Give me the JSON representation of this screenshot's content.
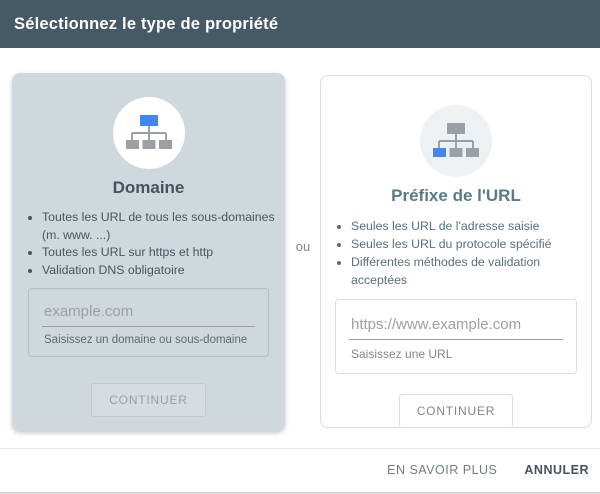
{
  "dialog": {
    "title": "Sélectionnez le type de propriété"
  },
  "divider_label": "ou",
  "cards": {
    "domain": {
      "title": "Domaine",
      "icon": "sitemap-tree-icon-blue-root",
      "bullets": [
        "Toutes les URL de tous les sous-domaines (m. www. ...)",
        "Toutes les URL sur https et http",
        "Validation DNS obligatoire"
      ],
      "input": {
        "value": "",
        "placeholder": "example.com",
        "helper": "Saisissez un domaine ou sous-domaine"
      },
      "button": "CONTINUER"
    },
    "url_prefix": {
      "title": "Préfixe de l'URL",
      "icon": "sitemap-tree-icon-blue-leaf",
      "bullets": [
        "Seules les URL de l'adresse saisie",
        "Seules les URL du protocole spécifié",
        "Différentes méthodes de validation acceptées"
      ],
      "input": {
        "value": "",
        "placeholder": "https://www.example.com",
        "helper": "Saisissez une URL"
      },
      "button": "CONTINUER"
    }
  },
  "footer": {
    "learn_more": "EN SAVOIR PLUS",
    "cancel": "ANNULER"
  },
  "colors": {
    "header_bg": "#455a64",
    "domain_card_bg": "#cfd8dc",
    "accent_blue": "#4285f4",
    "node_gray": "#9aa0a6",
    "border_gray": "#dadce0"
  }
}
